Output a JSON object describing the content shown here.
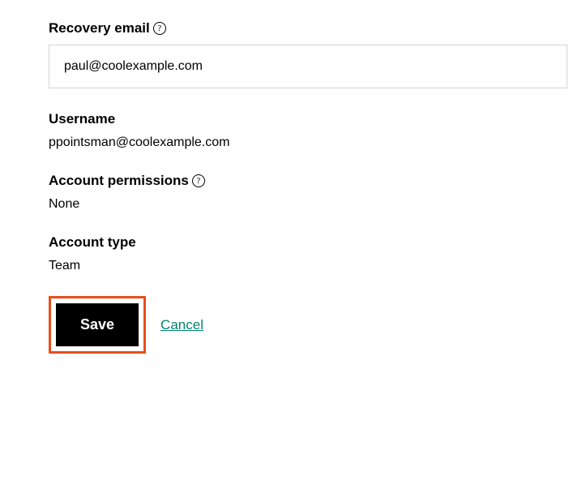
{
  "recovery": {
    "label": "Recovery email",
    "value": "paul@coolexample.com"
  },
  "username": {
    "label": "Username",
    "value": "ppointsman@coolexample.com"
  },
  "permissions": {
    "label": "Account permissions",
    "value": "None"
  },
  "account_type": {
    "label": "Account type",
    "value": "Team"
  },
  "actions": {
    "save": "Save",
    "cancel": "Cancel"
  },
  "icons": {
    "help": "?"
  }
}
